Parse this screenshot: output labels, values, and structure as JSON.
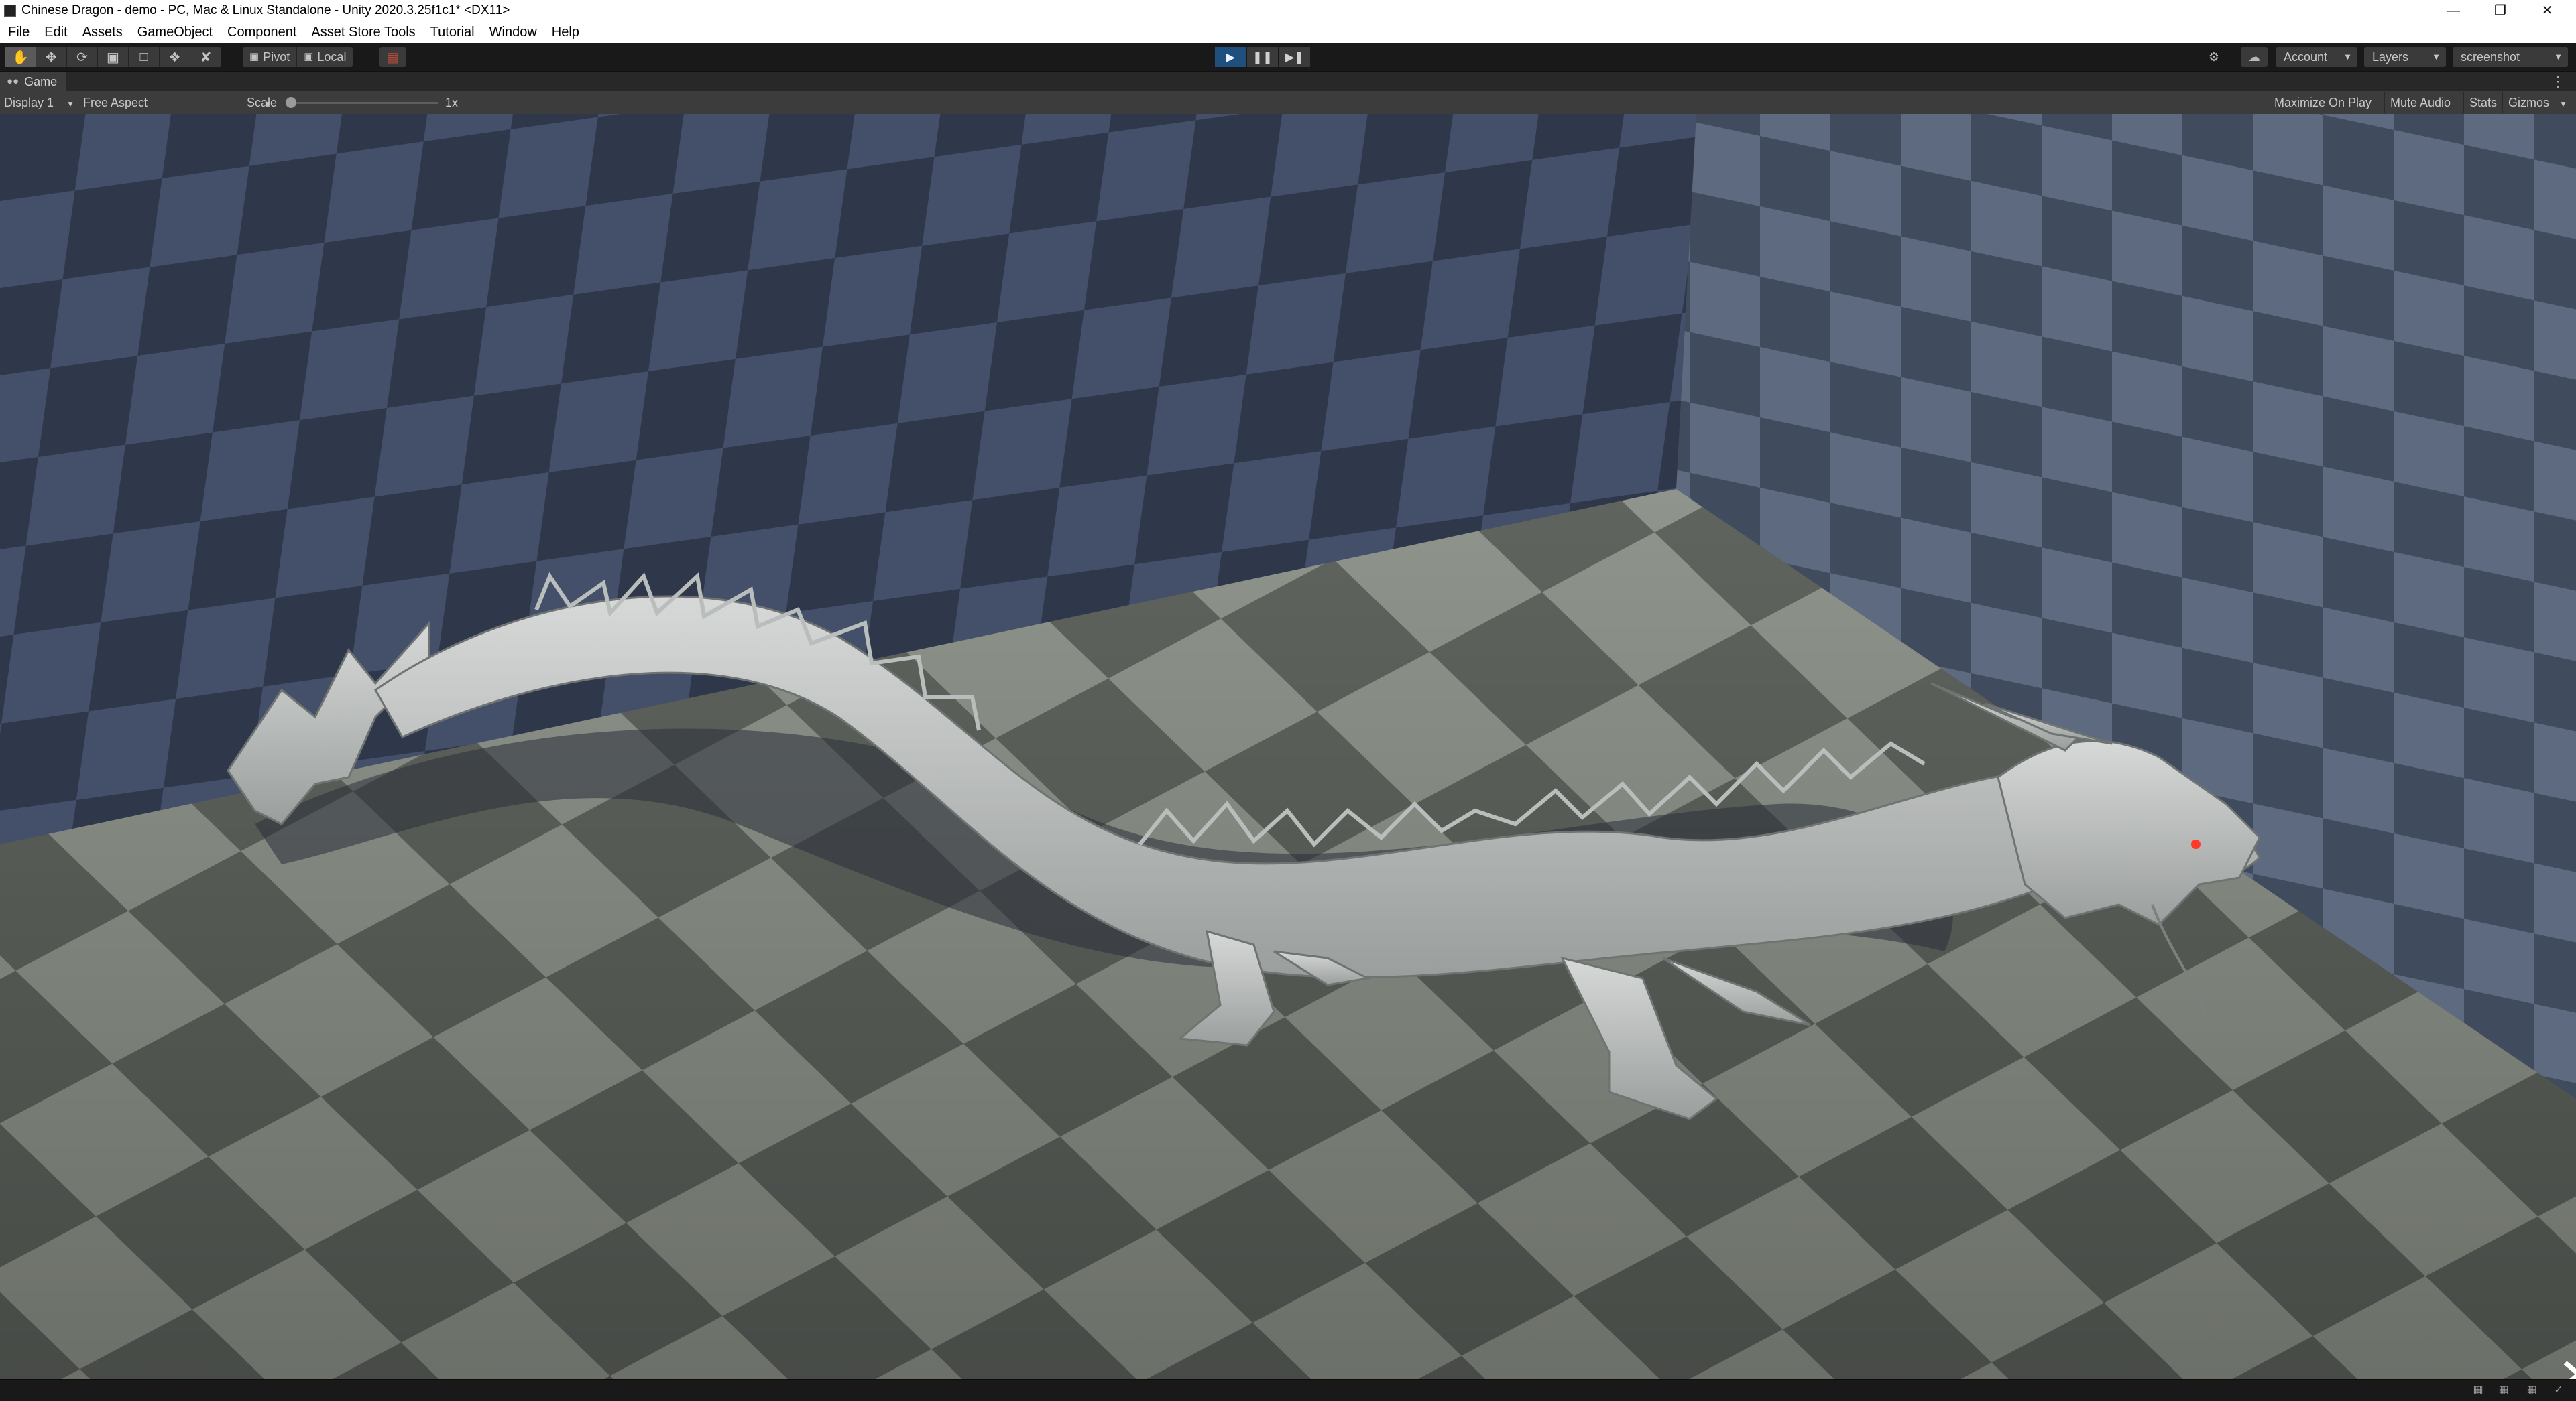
{
  "window": {
    "title": "Chinese Dragon - demo - PC, Mac & Linux Standalone - Unity 2020.3.25f1c1* <DX11>",
    "minimize_icon": "minimize-icon",
    "maximize_icon": "restore-icon",
    "close_icon": "close-icon"
  },
  "menu": [
    "File",
    "Edit",
    "Assets",
    "GameObject",
    "Component",
    "Asset Store Tools",
    "Tutorial",
    "Window",
    "Help"
  ],
  "toolbar": {
    "tools": [
      "hand-tool-icon",
      "move-tool-icon",
      "rotate-tool-icon",
      "scale-tool-icon",
      "rect-tool-icon",
      "transform-tool-icon",
      "custom-tool-icon"
    ],
    "pivot_label": "Pivot",
    "local_label": "Local",
    "snap_icon": "grid-snap-icon",
    "play_state": "playing",
    "account_label": "Account",
    "layers_label": "Layers",
    "layout_label": "screenshot",
    "accent_color": "#1e4f7d"
  },
  "game_tab": {
    "label": "Game"
  },
  "game_controls": {
    "display": "Display 1",
    "aspect": "Free Aspect",
    "scale_label": "Scale",
    "scale_value": "1x",
    "maximize_on_play": "Maximize On Play",
    "mute_audio": "Mute Audio",
    "stats": "Stats",
    "gizmos": "Gizmos"
  },
  "scene": {
    "subject": "dragon-model",
    "nav_prev_icon": "chevron-left-icon",
    "nav_next_icon": "chevron-right-icon"
  }
}
